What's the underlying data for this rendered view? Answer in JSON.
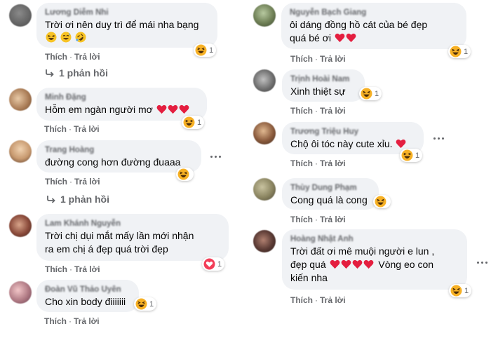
{
  "colors": {
    "bubble": "#f0f2f5",
    "secondary_text": "#65676b",
    "heart_red": "#e41e3f",
    "haha_yellow": "#f7b125"
  },
  "left": [
    {
      "author": "Lương Diễm Nhi",
      "lines": [
        "Trời ơi nên duy trì để mái nha bạng"
      ],
      "emoji_line": [
        "haha-emoji",
        "grin-sweat-emoji",
        "rofl-emoji"
      ],
      "reaction": {
        "icon": "haha-reaction-icon",
        "count": "1"
      },
      "actions": {
        "like": "Thích",
        "reply": "Trả lời"
      },
      "replies": "1 phản hồi"
    },
    {
      "author": "Minh Đặng",
      "lines": [
        "Hỗm em ngàn người mơ"
      ],
      "trailing_hearts": 3,
      "reaction": {
        "icon": "haha-reaction-icon",
        "count": "1"
      },
      "actions": {
        "like": "Thích",
        "reply": "Trả lời"
      }
    },
    {
      "author": "Trang Hoàng",
      "lines": [
        "đường cong hơn đường đuaaa"
      ],
      "reaction": {
        "icon": "haha-reaction-icon",
        "count": ""
      },
      "actions": {
        "like": "Thích",
        "reply": "Trả lời"
      },
      "replies": "1 phản hồi"
    },
    {
      "author": "Lam Khánh Nguyễn",
      "lines": [
        "Trời chị dụi mắt mấy lần mới nhận",
        "ra em chị á đẹp quá trời đẹp"
      ],
      "reaction": {
        "icon": "heart-reaction-icon",
        "count": "1"
      },
      "actions": {
        "like": "Thích",
        "reply": "Trả lời"
      }
    },
    {
      "author": "Đoàn Vũ Thảo Uyên",
      "lines": [
        "Cho xin body điiiiiii"
      ],
      "reaction": {
        "icon": "haha-reaction-icon",
        "count": "1"
      },
      "actions": {
        "like": "Thích",
        "reply": "Trả lời"
      }
    }
  ],
  "right": [
    {
      "author": "Nguyễn Bạch Giang",
      "lines": [
        "ôi dáng đồng hồ cát của bé đẹp",
        "quá bé ơi"
      ],
      "trailing_hearts": 2,
      "reaction": {
        "icon": "haha-reaction-icon",
        "count": "1"
      },
      "actions": {
        "like": "Thích",
        "reply": "Trả lời"
      }
    },
    {
      "author": "Trịnh Hoài Nam",
      "lines": [
        "Xinh thiệt sự"
      ],
      "reaction": {
        "icon": "haha-reaction-icon",
        "count": "1"
      },
      "actions": {
        "like": "Thích",
        "reply": "Trả lời"
      }
    },
    {
      "author": "Trương Triệu Huy",
      "lines": [
        "Chộ ôi tóc này cute xỉu."
      ],
      "trailing_hearts": 1,
      "reaction": {
        "icon": "haha-reaction-icon",
        "count": "1"
      },
      "actions": {
        "like": "Thích",
        "reply": "Trả lời"
      }
    },
    {
      "author": "Thùy Dung Phạm",
      "lines": [
        "Cong quá là cong"
      ],
      "reaction": {
        "icon": "haha-reaction-icon",
        "count": ""
      },
      "actions": {
        "like": "Thích",
        "reply": "Trả lời"
      }
    },
    {
      "author": "Hoàng Nhật Anh",
      "lines": [
        "Trời đất ơi mê muội người e lun ,",
        "đẹp quá",
        "kiến nha"
      ],
      "line2_suffix": "Vòng eo con",
      "reaction": {
        "icon": "haha-reaction-icon",
        "count": "1"
      },
      "actions": {
        "like": "Thích",
        "reply": "Trả lời"
      }
    }
  ]
}
